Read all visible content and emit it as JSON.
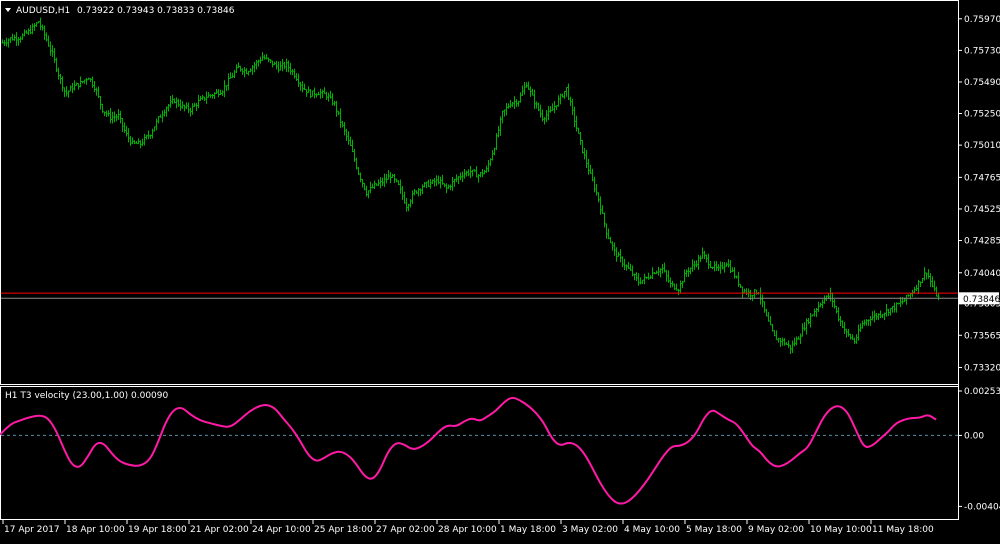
{
  "header": {
    "symbol": "AUDUSD,H1",
    "ohlc": "0.73922 0.73943 0.73833 0.73846"
  },
  "indicator": {
    "label": "H1 T3 velocity (23.00,1.00) 0.00090"
  },
  "colors": {
    "background": "#000000",
    "frame": "#ffffff",
    "bars": "#00b000",
    "indicator_line": "#ff1aa5",
    "zero_line": "#5a8aa5",
    "red_line": "#ff0000",
    "bid_line": "#8c8c8c"
  },
  "chart_data": [
    {
      "type": "ohlc",
      "name": "price",
      "ylim": [
        0.7321,
        0.7609
      ],
      "yticks": [
        "0.75970",
        "0.75730",
        "0.75490",
        "0.75250",
        "0.75010",
        "0.74765",
        "0.74525",
        "0.74285",
        "0.74040",
        "0.73805",
        "0.73565",
        "0.73320"
      ],
      "ytick_values": [
        0.7597,
        0.7573,
        0.7549,
        0.7525,
        0.7501,
        0.74765,
        0.74525,
        0.74285,
        0.7404,
        0.73805,
        0.73565,
        0.7332
      ],
      "price_tag": "0.73846",
      "current_price": 0.73846,
      "red_level": 0.73885,
      "xticks": [
        "17 Apr 2017",
        "18 Apr 10:00",
        "19 Apr 18:00",
        "21 Apr 02:00",
        "24 Apr 10:00",
        "25 Apr 18:00",
        "27 Apr 02:00",
        "28 Apr 10:00",
        "1 May 18:00",
        "3 May 02:00",
        "4 May 10:00",
        "5 May 18:00",
        "9 May 02:00",
        "10 May 10:00",
        "11 May 18:00"
      ],
      "close_path": [
        [
          0,
          0.7578
        ],
        [
          10,
          0.7582
        ],
        [
          20,
          0.7583
        ],
        [
          30,
          0.7588
        ],
        [
          38,
          0.7595
        ],
        [
          45,
          0.7583
        ],
        [
          52,
          0.757
        ],
        [
          58,
          0.7555
        ],
        [
          65,
          0.754
        ],
        [
          72,
          0.7545
        ],
        [
          80,
          0.7548
        ],
        [
          88,
          0.7553
        ],
        [
          95,
          0.7544
        ],
        [
          102,
          0.7528
        ],
        [
          110,
          0.7522
        ],
        [
          118,
          0.7523
        ],
        [
          125,
          0.751
        ],
        [
          132,
          0.7502
        ],
        [
          140,
          0.7502
        ],
        [
          150,
          0.751
        ],
        [
          158,
          0.7521
        ],
        [
          166,
          0.753
        ],
        [
          174,
          0.7535
        ],
        [
          182,
          0.753
        ],
        [
          190,
          0.7528
        ],
        [
          198,
          0.7534
        ],
        [
          206,
          0.7538
        ],
        [
          214,
          0.754
        ],
        [
          222,
          0.7543
        ],
        [
          230,
          0.7552
        ],
        [
          238,
          0.756
        ],
        [
          246,
          0.7557
        ],
        [
          254,
          0.7562
        ],
        [
          262,
          0.7568
        ],
        [
          270,
          0.7564
        ],
        [
          278,
          0.756
        ],
        [
          286,
          0.7562
        ],
        [
          294,
          0.7555
        ],
        [
          302,
          0.7545
        ],
        [
          310,
          0.754
        ],
        [
          318,
          0.7541
        ],
        [
          326,
          0.7539
        ],
        [
          334,
          0.7532
        ],
        [
          342,
          0.7515
        ],
        [
          350,
          0.75
        ],
        [
          358,
          0.748
        ],
        [
          366,
          0.7465
        ],
        [
          374,
          0.747
        ],
        [
          382,
          0.7473
        ],
        [
          390,
          0.7478
        ],
        [
          398,
          0.747
        ],
        [
          406,
          0.7455
        ],
        [
          414,
          0.7465
        ],
        [
          422,
          0.747
        ],
        [
          430,
          0.7472
        ],
        [
          438,
          0.7474
        ],
        [
          446,
          0.7468
        ],
        [
          454,
          0.7474
        ],
        [
          462,
          0.7479
        ],
        [
          470,
          0.7481
        ],
        [
          478,
          0.7478
        ],
        [
          486,
          0.7482
        ],
        [
          494,
          0.75
        ],
        [
          502,
          0.7525
        ],
        [
          510,
          0.7533
        ],
        [
          518,
          0.7535
        ],
        [
          526,
          0.7548
        ],
        [
          534,
          0.7534
        ],
        [
          542,
          0.7522
        ],
        [
          550,
          0.7526
        ],
        [
          558,
          0.7535
        ],
        [
          566,
          0.7544
        ],
        [
          574,
          0.752
        ],
        [
          582,
          0.7497
        ],
        [
          590,
          0.7478
        ],
        [
          598,
          0.746
        ],
        [
          606,
          0.7435
        ],
        [
          614,
          0.742
        ],
        [
          622,
          0.7412
        ],
        [
          630,
          0.7405
        ],
        [
          638,
          0.7397
        ],
        [
          646,
          0.74
        ],
        [
          654,
          0.7405
        ],
        [
          662,
          0.7407
        ],
        [
          670,
          0.7395
        ],
        [
          678,
          0.7392
        ],
        [
          686,
          0.7405
        ],
        [
          694,
          0.741
        ],
        [
          702,
          0.7418
        ],
        [
          710,
          0.741
        ],
        [
          718,
          0.7406
        ],
        [
          726,
          0.7412
        ],
        [
          734,
          0.7402
        ],
        [
          742,
          0.7391
        ],
        [
          750,
          0.7388
        ],
        [
          758,
          0.739
        ],
        [
          766,
          0.737
        ],
        [
          774,
          0.7355
        ],
        [
          782,
          0.7352
        ],
        [
          790,
          0.7347
        ],
        [
          798,
          0.7355
        ],
        [
          806,
          0.7366
        ],
        [
          814,
          0.7375
        ],
        [
          822,
          0.7383
        ],
        [
          830,
          0.7387
        ],
        [
          838,
          0.737
        ],
        [
          846,
          0.7358
        ],
        [
          854,
          0.7352
        ],
        [
          862,
          0.7365
        ],
        [
          870,
          0.737
        ],
        [
          878,
          0.7372
        ],
        [
          886,
          0.7375
        ],
        [
          894,
          0.7378
        ],
        [
          902,
          0.7382
        ],
        [
          910,
          0.7388
        ],
        [
          918,
          0.7396
        ],
        [
          926,
          0.7405
        ],
        [
          934,
          0.739
        ],
        [
          938,
          0.7385
        ]
      ]
    },
    {
      "type": "line",
      "name": "indicator",
      "ylim": [
        -0.0047,
        0.0027
      ],
      "yticks": [
        "0.00253",
        "0.00",
        "-0.00404"
      ],
      "ytick_values": [
        0.00253,
        0.0,
        -0.00404
      ],
      "zero_level": 0.0,
      "points": [
        [
          0,
          5e-05
        ],
        [
          10,
          0.00065
        ],
        [
          20,
          0.00085
        ],
        [
          30,
          0.00105
        ],
        [
          40,
          0.00115
        ],
        [
          48,
          0.001
        ],
        [
          56,
          0.0003
        ],
        [
          64,
          -0.0008
        ],
        [
          72,
          -0.0017
        ],
        [
          80,
          -0.00185
        ],
        [
          88,
          -0.0012
        ],
        [
          96,
          -0.0004
        ],
        [
          104,
          -0.00045
        ],
        [
          112,
          -0.00105
        ],
        [
          120,
          -0.0015
        ],
        [
          130,
          -0.0017
        ],
        [
          140,
          -0.00175
        ],
        [
          150,
          -0.0014
        ],
        [
          158,
          -0.0004
        ],
        [
          166,
          0.0008
        ],
        [
          174,
          0.0015
        ],
        [
          182,
          0.0016
        ],
        [
          190,
          0.0012
        ],
        [
          200,
          0.00085
        ],
        [
          210,
          0.0007
        ],
        [
          220,
          0.00055
        ],
        [
          230,
          0.00045
        ],
        [
          240,
          0.0009
        ],
        [
          250,
          0.0014
        ],
        [
          260,
          0.0017
        ],
        [
          268,
          0.00175
        ],
        [
          276,
          0.0015
        ],
        [
          284,
          0.0009
        ],
        [
          292,
          0.0004
        ],
        [
          300,
          -0.0003
        ],
        [
          308,
          -0.0011
        ],
        [
          316,
          -0.0015
        ],
        [
          324,
          -0.0013
        ],
        [
          332,
          -0.001
        ],
        [
          340,
          -0.0009
        ],
        [
          348,
          -0.0011
        ],
        [
          356,
          -0.0016
        ],
        [
          364,
          -0.0023
        ],
        [
          372,
          -0.00255
        ],
        [
          380,
          -0.002
        ],
        [
          388,
          -0.0009
        ],
        [
          396,
          -0.0004
        ],
        [
          404,
          -0.0005
        ],
        [
          412,
          -0.0008
        ],
        [
          420,
          -0.0007
        ],
        [
          430,
          -0.0003
        ],
        [
          440,
          0.0003
        ],
        [
          448,
          0.0006
        ],
        [
          456,
          0.0005
        ],
        [
          464,
          0.0008
        ],
        [
          472,
          0.001
        ],
        [
          480,
          0.0008
        ],
        [
          488,
          0.0011
        ],
        [
          496,
          0.0014
        ],
        [
          504,
          0.0019
        ],
        [
          512,
          0.0022
        ],
        [
          520,
          0.002
        ],
        [
          528,
          0.0017
        ],
        [
          536,
          0.0013
        ],
        [
          544,
          0.0007
        ],
        [
          552,
          -0.0002
        ],
        [
          560,
          -0.0006
        ],
        [
          568,
          -0.0004
        ],
        [
          576,
          -0.0005
        ],
        [
          584,
          -0.001
        ],
        [
          592,
          -0.0018
        ],
        [
          600,
          -0.0027
        ],
        [
          608,
          -0.0034
        ],
        [
          616,
          -0.00385
        ],
        [
          624,
          -0.0039
        ],
        [
          632,
          -0.0036
        ],
        [
          640,
          -0.0031
        ],
        [
          648,
          -0.0025
        ],
        [
          656,
          -0.0018
        ],
        [
          664,
          -0.0011
        ],
        [
          672,
          -0.0006
        ],
        [
          680,
          -0.0006
        ],
        [
          688,
          -0.0004
        ],
        [
          696,
          0.0001
        ],
        [
          704,
          0.001
        ],
        [
          712,
          0.0015
        ],
        [
          720,
          0.0012
        ],
        [
          728,
          0.0009
        ],
        [
          736,
          0.0007
        ],
        [
          744,
          0.0001
        ],
        [
          752,
          -0.0006
        ],
        [
          760,
          -0.0009
        ],
        [
          768,
          -0.0015
        ],
        [
          776,
          -0.0018
        ],
        [
          784,
          -0.0017
        ],
        [
          792,
          -0.0014
        ],
        [
          800,
          -0.001
        ],
        [
          808,
          -0.0007
        ],
        [
          816,
          0.0002
        ],
        [
          824,
          0.0011
        ],
        [
          832,
          0.0016
        ],
        [
          840,
          0.0017
        ],
        [
          848,
          0.0013
        ],
        [
          856,
          0.0003
        ],
        [
          864,
          -0.0007
        ],
        [
          872,
          -0.0006
        ],
        [
          880,
          -0.0002
        ],
        [
          888,
          0.0002
        ],
        [
          896,
          0.0007
        ],
        [
          904,
          0.0009
        ],
        [
          912,
          0.001
        ],
        [
          920,
          0.001
        ],
        [
          928,
          0.0012
        ],
        [
          936,
          0.0009
        ]
      ]
    }
  ]
}
